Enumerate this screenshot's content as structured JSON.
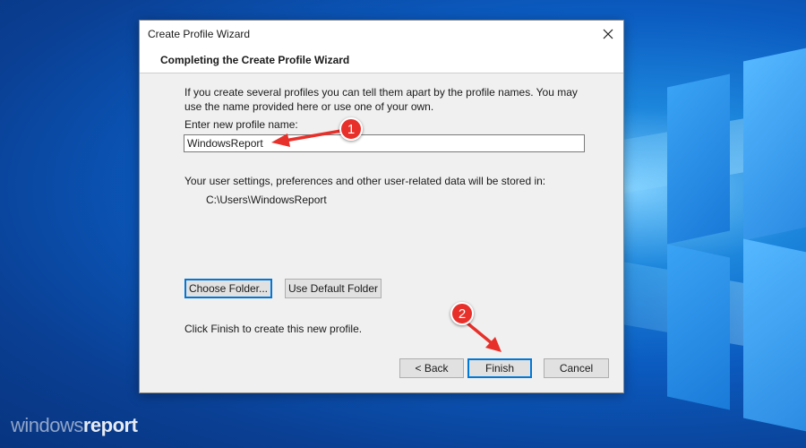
{
  "desktop": {
    "watermark_part1": "windows",
    "watermark_part2": "report",
    "accent_color": "#0b5bc0"
  },
  "dialog": {
    "title": "Create Profile Wizard",
    "close_icon": "close-icon",
    "header": "Completing the Create Profile Wizard",
    "intro_text": "If you create several profiles you can tell them apart by the profile names. You may use the name provided here or use one of your own.",
    "name_label": "Enter new profile name:",
    "name_value": "WindowsReport",
    "storage_label": "Your user settings, preferences and other user-related data will be stored in:",
    "storage_path": "C:\\Users\\WindowsReport",
    "choose_folder_label": "Choose Folder...",
    "use_default_folder_label": "Use Default Folder",
    "finish_hint": "Click Finish to create this new profile.",
    "back_label": "< Back",
    "finish_label": "Finish",
    "cancel_label": "Cancel"
  },
  "annotations": {
    "step1": "1",
    "step2": "2",
    "color": "#e8302a"
  }
}
